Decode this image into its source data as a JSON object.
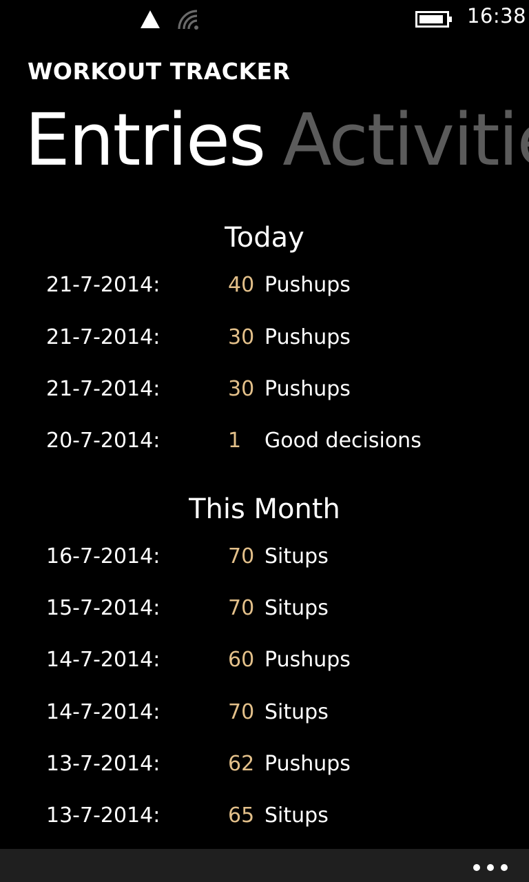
{
  "status_bar": {
    "time": "16:38",
    "icons": [
      "signal-icon",
      "wifi-icon",
      "battery-icon"
    ]
  },
  "app": {
    "title": "WORKOUT TRACKER"
  },
  "pivot": {
    "items": [
      {
        "label": "Entries",
        "active": true
      },
      {
        "label": "Activities",
        "active": false
      }
    ]
  },
  "sections": [
    {
      "header": "Today",
      "entries": [
        {
          "date": "21-7-2014:",
          "amount": "40",
          "activity": "Pushups"
        },
        {
          "date": "21-7-2014:",
          "amount": "30",
          "activity": "Pushups"
        },
        {
          "date": "21-7-2014:",
          "amount": "30",
          "activity": "Pushups"
        },
        {
          "date": "20-7-2014:",
          "amount": "1",
          "activity": "Good decisions"
        }
      ]
    },
    {
      "header": "This Month",
      "entries": [
        {
          "date": "16-7-2014:",
          "amount": "70",
          "activity": "Situps"
        },
        {
          "date": "15-7-2014:",
          "amount": "70",
          "activity": "Situps"
        },
        {
          "date": "14-7-2014:",
          "amount": "60",
          "activity": "Pushups"
        },
        {
          "date": "14-7-2014:",
          "amount": "70",
          "activity": "Situps"
        },
        {
          "date": "13-7-2014:",
          "amount": "62",
          "activity": "Pushups"
        },
        {
          "date": "13-7-2014:",
          "amount": "65",
          "activity": "Situps"
        }
      ]
    }
  ],
  "app_bar": {
    "more_icon": "more-icon"
  },
  "colors": {
    "background": "#000000",
    "amount_accent": "#e3c08a",
    "inactive_pivot": "#5b5b5b",
    "app_bar": "#1f1f1f"
  }
}
